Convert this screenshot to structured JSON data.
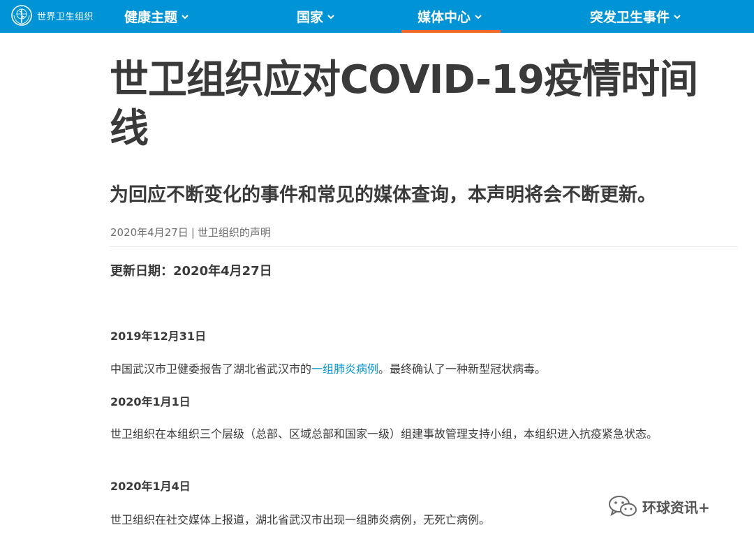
{
  "header": {
    "logo_text": "世界卫生组织",
    "nav": [
      {
        "label": "健康主题"
      },
      {
        "label": "国家"
      },
      {
        "label": "媒体中心",
        "active": true
      },
      {
        "label": "突发卫生事件"
      }
    ],
    "colors": {
      "bar": "#0093d5",
      "active_indicator": "#f26829"
    }
  },
  "article": {
    "title": "世卫组织应对COVID-19疫情时间线",
    "subtitle": "为回应不断变化的事件和常见的媒体查询，本声明将会不断更新。",
    "meta_date": "2020年4月27日",
    "meta_separator": "|",
    "meta_type": "世卫组织的声明",
    "updated": "更新日期：2020年4月27日",
    "entries": [
      {
        "date": "2019年12月31日",
        "text_before": "中国武汉市卫健委报告了湖北省武汉市的",
        "link": "一组肺炎病例",
        "text_after": "。最终确认了一种新型冠状病毒。"
      },
      {
        "date": "2020年1月1日",
        "text": "世卫组织在本组织三个层级（总部、区域总部和国家一级）组建事故管理支持小组，本组织进入抗疫紧急状态。"
      },
      {
        "date": "2020年1月4日",
        "text": "世卫组织在社交媒体上报道，湖北省武汉市出现一组肺炎病例，无死亡病例。"
      }
    ]
  },
  "watermark": {
    "text": "环球资讯+",
    "icon": "wechat-icon"
  }
}
